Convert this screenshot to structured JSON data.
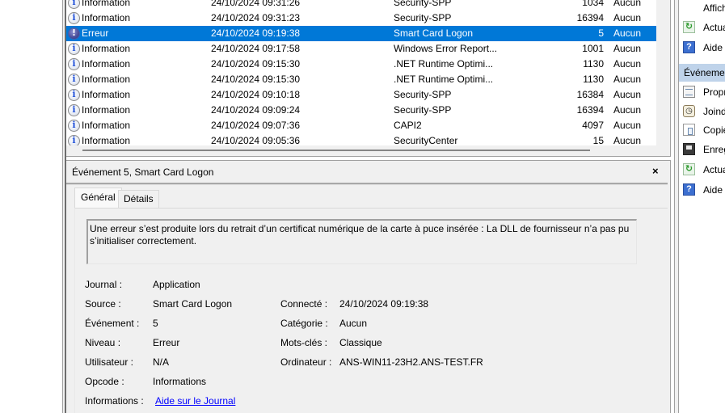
{
  "events": [
    {
      "level": "Information",
      "icon": "info-icon",
      "date": "24/10/2024 09:31:26",
      "source": "Security-SPP",
      "id": "1034",
      "task": "Aucun",
      "selected": false
    },
    {
      "level": "Information",
      "icon": "info-icon",
      "date": "24/10/2024 09:31:23",
      "source": "Security-SPP",
      "id": "16394",
      "task": "Aucun",
      "selected": false
    },
    {
      "level": "Erreur",
      "icon": "error-icon",
      "date": "24/10/2024 09:19:38",
      "source": "Smart Card Logon",
      "id": "5",
      "task": "Aucun",
      "selected": true
    },
    {
      "level": "Information",
      "icon": "info-icon",
      "date": "24/10/2024 09:17:58",
      "source": "Windows Error Report...",
      "id": "1001",
      "task": "Aucun",
      "selected": false
    },
    {
      "level": "Information",
      "icon": "info-icon",
      "date": "24/10/2024 09:15:30",
      "source": ".NET Runtime Optimi...",
      "id": "1130",
      "task": "Aucun",
      "selected": false
    },
    {
      "level": "Information",
      "icon": "info-icon",
      "date": "24/10/2024 09:15:30",
      "source": ".NET Runtime Optimi...",
      "id": "1130",
      "task": "Aucun",
      "selected": false
    },
    {
      "level": "Information",
      "icon": "info-icon",
      "date": "24/10/2024 09:10:18",
      "source": "Security-SPP",
      "id": "16384",
      "task": "Aucun",
      "selected": false
    },
    {
      "level": "Information",
      "icon": "info-icon",
      "date": "24/10/2024 09:09:24",
      "source": "Security-SPP",
      "id": "16394",
      "task": "Aucun",
      "selected": false
    },
    {
      "level": "Information",
      "icon": "info-icon",
      "date": "24/10/2024 09:07:36",
      "source": "CAPI2",
      "id": "4097",
      "task": "Aucun",
      "selected": false
    },
    {
      "level": "Information",
      "icon": "info-icon",
      "date": "24/10/2024 09:05:36",
      "source": "SecurityCenter",
      "id": "15",
      "task": "Aucun",
      "selected": false
    }
  ],
  "detail": {
    "title": "Événement 5, Smart Card Logon",
    "close_icon": "×",
    "tabs": [
      "Général",
      "Détails"
    ],
    "description": "Une erreur s’est produite lors du retrait d’un certificat numérique de la carte à puce insérée : La DLL de fournisseur n’a pas pu s’initialiser correctement.",
    "fields_left": [
      {
        "label": "Journal :",
        "value": "Application"
      },
      {
        "label": "Source :",
        "value": "Smart Card Logon"
      },
      {
        "label": "Événement :",
        "value": "5"
      },
      {
        "label": "Niveau :",
        "value": "Erreur"
      },
      {
        "label": "Utilisateur :",
        "value": "N/A"
      },
      {
        "label": "Opcode :",
        "value": "Informations"
      },
      {
        "label": "Informations :",
        "value": "Aide sur le Journal",
        "link": true
      }
    ],
    "fields_right": [
      {
        "label": "Connecté :",
        "value": "24/10/2024 09:19:38"
      },
      {
        "label": "Catégorie :",
        "value": "Aucun"
      },
      {
        "label": "Mots-clés :",
        "value": "Classique"
      },
      {
        "label": "Ordinateur :",
        "value": "ANS-WIN11-23H2.ANS-TEST.FR"
      }
    ]
  },
  "actions": {
    "top_items": [
      {
        "label": "Affich",
        "icon": ""
      },
      {
        "label": "Actua",
        "icon": "refresh-icon"
      },
      {
        "label": "Aide",
        "icon": "help-icon"
      }
    ],
    "section_title": "Événemen",
    "section_items": [
      {
        "label": "Propr",
        "icon": "properties-icon"
      },
      {
        "label": "Joind",
        "icon": "attach-task-icon"
      },
      {
        "label": "Copie",
        "icon": "copy-icon"
      },
      {
        "label": "Enreg",
        "icon": "save-icon"
      },
      {
        "label": "Actua",
        "icon": "refresh-icon"
      },
      {
        "label": "Aide",
        "icon": "help-icon"
      }
    ]
  },
  "colors": {
    "selection": "#0078d7",
    "link": "#0000ff",
    "action_header": "#bfd3ea"
  }
}
